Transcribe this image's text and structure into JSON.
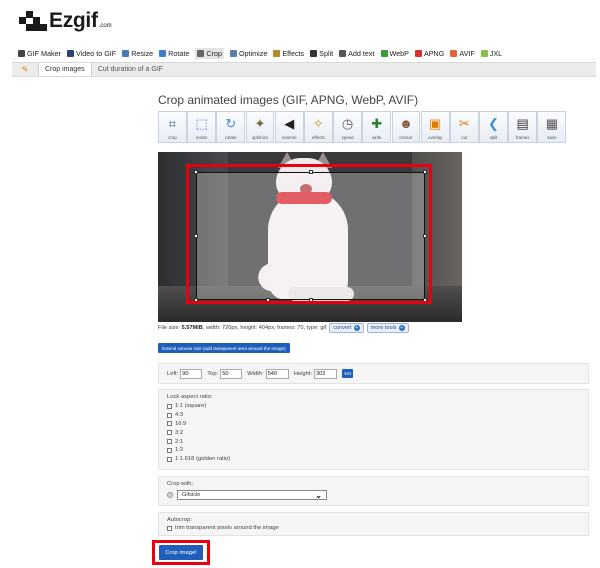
{
  "logo": {
    "text": "Ezgif",
    "suffix": ".com"
  },
  "main_nav": [
    {
      "label": "GIF Maker",
      "icon": "gif-maker-icon",
      "color": "#444444"
    },
    {
      "label": "Video to GIF",
      "icon": "video-icon",
      "color": "#2a3f7a"
    },
    {
      "label": "Resize",
      "icon": "resize-icon",
      "color": "#4a78c0"
    },
    {
      "label": "Rotate",
      "icon": "rotate-icon",
      "color": "#3f7fc9"
    },
    {
      "label": "Crop",
      "icon": "crop-icon",
      "color": "#666666",
      "active": true
    },
    {
      "label": "Optimize",
      "icon": "optimize-icon",
      "color": "#5b7fb0"
    },
    {
      "label": "Effects",
      "icon": "effects-icon",
      "color": "#b38a2a"
    },
    {
      "label": "Split",
      "icon": "split-icon",
      "color": "#333333"
    },
    {
      "label": "Add text",
      "icon": "add-text-icon",
      "color": "#555555"
    },
    {
      "label": "WebP",
      "icon": "webp-icon",
      "color": "#3a9a3a"
    },
    {
      "label": "APNG",
      "icon": "apng-icon",
      "color": "#d33333"
    },
    {
      "label": "AVIF",
      "icon": "avif-icon",
      "color": "#e0653a"
    },
    {
      "label": "JXL",
      "icon": "jxl-icon",
      "color": "#8ac04a"
    }
  ],
  "sub_nav": {
    "icon": "✎",
    "tabs": [
      {
        "label": "Crop images",
        "active": true
      },
      {
        "label": "Cut duration of a GIF",
        "active": false
      }
    ]
  },
  "page_title": "Crop animated images (GIF, APNG, WebP, AVIF)",
  "tools": [
    {
      "label": "crop",
      "icon": "crop-tool-icon",
      "glyph": "⌗",
      "color": "#3a5f9a"
    },
    {
      "label": "resize",
      "icon": "resize-tool-icon",
      "glyph": "⬚",
      "color": "#4a7ac0"
    },
    {
      "label": "rotate",
      "icon": "rotate-tool-icon",
      "glyph": "↻",
      "color": "#4a88cc"
    },
    {
      "label": "optimize",
      "icon": "optimize-tool-icon",
      "glyph": "✦",
      "color": "#7a6a3a"
    },
    {
      "label": "reverse",
      "icon": "reverse-tool-icon",
      "glyph": "◀",
      "color": "#222222"
    },
    {
      "label": "effects",
      "icon": "effects-tool-icon",
      "glyph": "✧",
      "color": "#c49a20"
    },
    {
      "label": "speed",
      "icon": "speed-tool-icon",
      "glyph": "◷",
      "color": "#555555"
    },
    {
      "label": "write",
      "icon": "write-tool-icon",
      "glyph": "✚",
      "color": "#2e7d32"
    },
    {
      "label": "censor",
      "icon": "censor-tool-icon",
      "glyph": "☻",
      "color": "#8a5a3a"
    },
    {
      "label": "overlay",
      "icon": "overlay-tool-icon",
      "glyph": "▣",
      "color": "#e07b00"
    },
    {
      "label": "cut",
      "icon": "cut-tool-icon",
      "glyph": "✂",
      "color": "#e07b00"
    },
    {
      "label": "split",
      "icon": "split-tool-icon",
      "glyph": "❮",
      "color": "#3a8fd0"
    },
    {
      "label": "frames",
      "icon": "frames-tool-icon",
      "glyph": "▤",
      "color": "#333333"
    },
    {
      "label": "save",
      "icon": "save-tool-icon",
      "glyph": "▦",
      "color": "#555555"
    }
  ],
  "file_info": {
    "label": "File size:",
    "size": "5.57MiB",
    "details": ", width: 720px, height: 404px, frames: 70, type: gif",
    "convert_label": "convert",
    "more_tools_label": "more tools"
  },
  "extend_button": "Extend canvas size (add transparent area around the image)",
  "coords": {
    "left_label": "Left:",
    "left_value": "90",
    "top_label": "Top:",
    "top_value": "50",
    "width_label": "Width:",
    "width_value": "540",
    "height_label": "Height:",
    "height_value": "303",
    "set_label": "Set"
  },
  "aspect_ratio": {
    "title": "Lock aspect ratio:",
    "options": [
      "1:1 (square)",
      "4:3",
      "16:9",
      "3:2",
      "2:1",
      "1:2",
      "1:1.618 (golden ratio)"
    ]
  },
  "crop_with": {
    "title": "Crop with:",
    "selected": "Gifsicle"
  },
  "autocrop": {
    "title": "Autocrop:",
    "option": "trim transparent pixels around the image"
  },
  "crop_button": "Crop image!",
  "accent_colors": {
    "button_blue": "#1f5fbb",
    "highlight_red": "#e8000c"
  }
}
